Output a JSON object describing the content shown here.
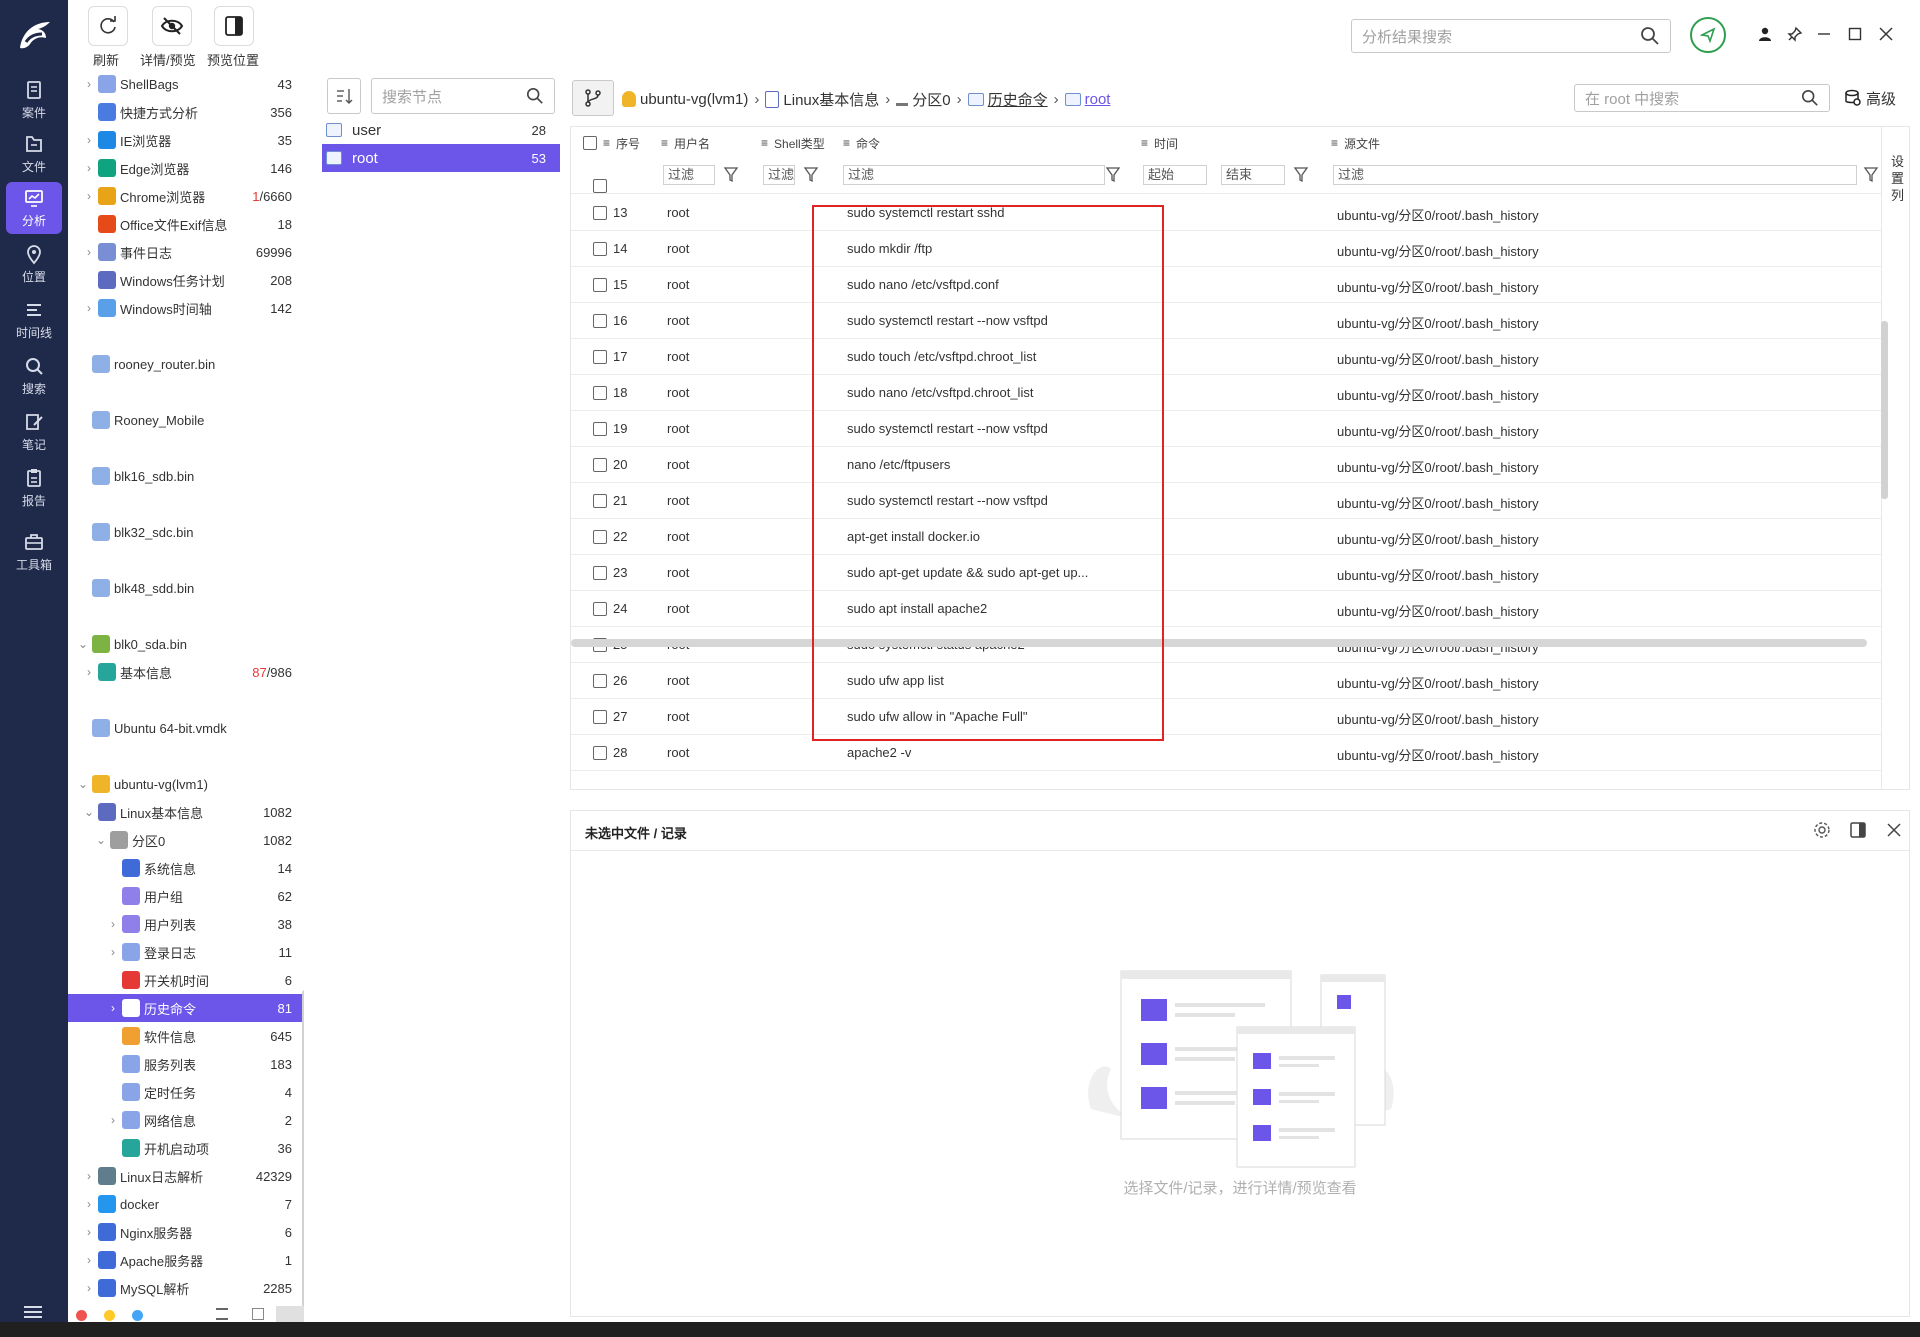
{
  "nav": {
    "items": [
      {
        "id": "case",
        "label": "案件"
      },
      {
        "id": "file",
        "label": "文件"
      },
      {
        "id": "analysis",
        "label": "分析",
        "active": true
      },
      {
        "id": "location",
        "label": "位置"
      },
      {
        "id": "timeline",
        "label": "时间线"
      },
      {
        "id": "search",
        "label": "搜索"
      },
      {
        "id": "notes",
        "label": "笔记"
      },
      {
        "id": "report",
        "label": "报告"
      },
      {
        "id": "toolbox",
        "label": "工具箱"
      }
    ]
  },
  "toolbar": {
    "refresh_label": "刷新",
    "detail_label": "详情/预览",
    "preview_pos_label": "预览位置"
  },
  "global_search": {
    "placeholder": "分析结果搜索"
  },
  "tree": {
    "items": [
      {
        "label": "ShellBags",
        "count": "43",
        "icon": "folder-icon",
        "color": "#8aa4e8",
        "indent": 1,
        "chev": true
      },
      {
        "label": "快捷方式分析",
        "count": "356",
        "icon": "shortcut-icon",
        "color": "#4a7be0",
        "indent": 1,
        "chev": false
      },
      {
        "label": "IE浏览器",
        "count": "35",
        "icon": "ie-icon",
        "color": "#1e88e5",
        "indent": 1,
        "chev": true
      },
      {
        "label": "Edge浏览器",
        "count": "146",
        "icon": "edge-icon",
        "color": "#10a37f",
        "indent": 1,
        "chev": true
      },
      {
        "label": "Chrome浏览器",
        "count_red": "1",
        "count": "/6660",
        "icon": "chrome-icon",
        "color": "#e8a317",
        "indent": 1,
        "chev": true
      },
      {
        "label": "Office文件Exif信息",
        "count": "18",
        "icon": "office-icon",
        "color": "#e64a19",
        "indent": 1,
        "chev": false
      },
      {
        "label": "事件日志",
        "count": "69996",
        "icon": "event-log-icon",
        "color": "#7a8ed6",
        "indent": 1,
        "chev": true
      },
      {
        "label": "Windows任务计划",
        "count": "208",
        "icon": "task-scheduler-icon",
        "color": "#5c6bc0",
        "indent": 1,
        "chev": false
      },
      {
        "label": "Windows时间轴",
        "count": "142",
        "icon": "timeline-icon",
        "color": "#5aa0e8",
        "indent": 1,
        "chev": true
      },
      {
        "label": "rooney_router.bin",
        "count": "",
        "icon": "disk-file-icon",
        "color": "#8fb0e6",
        "indent": 0,
        "chev": false,
        "gap": true
      },
      {
        "label": "Rooney_Mobile",
        "count": "",
        "icon": "disk-file-icon",
        "color": "#8fb0e6",
        "indent": 0,
        "chev": false,
        "gap": true
      },
      {
        "label": "blk16_sdb.bin",
        "count": "",
        "icon": "disk-file-icon",
        "color": "#8fb0e6",
        "indent": 0,
        "chev": false,
        "gap": true
      },
      {
        "label": "blk32_sdc.bin",
        "count": "",
        "icon": "disk-file-icon",
        "color": "#8fb0e6",
        "indent": 0,
        "chev": false,
        "gap": true
      },
      {
        "label": "blk48_sdd.bin",
        "count": "",
        "icon": "disk-file-icon",
        "color": "#8fb0e6",
        "indent": 0,
        "chev": false,
        "gap": true
      },
      {
        "label": "blk0_sda.bin",
        "count": "",
        "icon": "android-icon",
        "color": "#7cb342",
        "indent": 0,
        "chev": true,
        "gap": true
      },
      {
        "label": "基本信息",
        "count_red": "87",
        "count": "/986",
        "icon": "info-icon",
        "color": "#26a69a",
        "indent": 1,
        "chev": true
      },
      {
        "label": "Ubuntu 64-bit.vmdk",
        "count": "",
        "icon": "disk-file-icon",
        "color": "#8fb0e6",
        "indent": 0,
        "chev": false,
        "gap": true
      },
      {
        "label": "ubuntu-vg(lvm1)",
        "count": "",
        "icon": "linux-icon",
        "color": "#f0b429",
        "indent": 0,
        "chev": true,
        "gap": true
      },
      {
        "label": "Linux基本信息",
        "count": "1082",
        "icon": "linux-info-icon",
        "color": "#5c6bc0",
        "indent": 1,
        "chev": true
      },
      {
        "label": "分区0",
        "count": "1082",
        "icon": "partition-icon",
        "color": "#9e9e9e",
        "indent": 2,
        "chev": true
      },
      {
        "label": "系统信息",
        "count": "14",
        "icon": "system-info-icon",
        "color": "#3f6bd8",
        "indent": 3,
        "chev": false
      },
      {
        "label": "用户组",
        "count": "62",
        "icon": "user-group-icon",
        "color": "#8f7fe8",
        "indent": 3,
        "chev": false
      },
      {
        "label": "用户列表",
        "count": "38",
        "icon": "user-list-icon",
        "color": "#8f7fe8",
        "indent": 3,
        "chev": true
      },
      {
        "label": "登录日志",
        "count": "11",
        "icon": "login-log-icon",
        "color": "#8aa4e8",
        "indent": 3,
        "chev": true
      },
      {
        "label": "开关机时间",
        "count": "6",
        "icon": "power-icon",
        "color": "#e53935",
        "indent": 3,
        "chev": false
      },
      {
        "label": "历史命令",
        "count": "81",
        "icon": "history-icon",
        "color": "#ffffff",
        "indent": 3,
        "chev": true,
        "selected": true
      },
      {
        "label": "软件信息",
        "count": "645",
        "icon": "software-icon",
        "color": "#f0a030",
        "indent": 3,
        "chev": false
      },
      {
        "label": "服务列表",
        "count": "183",
        "icon": "service-icon",
        "color": "#8aa4e8",
        "indent": 3,
        "chev": false
      },
      {
        "label": "定时任务",
        "count": "4",
        "icon": "cron-icon",
        "color": "#8aa4e8",
        "indent": 3,
        "chev": false
      },
      {
        "label": "网络信息",
        "count": "2",
        "icon": "network-icon",
        "color": "#8aa4e8",
        "indent": 3,
        "chev": true
      },
      {
        "label": "开机启动项",
        "count": "36",
        "icon": "startup-icon",
        "color": "#26a69a",
        "indent": 3,
        "chev": false
      },
      {
        "label": "Linux日志解析",
        "count": "42329",
        "icon": "linux-log-icon",
        "color": "#607d8b",
        "indent": 1,
        "chev": true
      },
      {
        "label": "docker",
        "count": "7",
        "icon": "docker-icon",
        "color": "#2496ed",
        "indent": 1,
        "chev": true
      },
      {
        "label": "Nginx服务器",
        "count": "6",
        "icon": "nginx-icon",
        "color": "#3f6bd8",
        "indent": 1,
        "chev": true
      },
      {
        "label": "Apache服务器",
        "count": "1",
        "icon": "apache-icon",
        "color": "#3f6bd8",
        "indent": 1,
        "chev": true
      },
      {
        "label": "MySQL解析",
        "count": "2285",
        "icon": "mysql-icon",
        "color": "#3f6bd8",
        "indent": 1,
        "chev": true
      }
    ]
  },
  "nodes": {
    "search_placeholder": "搜索节点",
    "items": [
      {
        "name": "user",
        "count": "28"
      },
      {
        "name": "root",
        "count": "53",
        "selected": true
      }
    ]
  },
  "breadcrumb": {
    "items": [
      "ubuntu-vg(lvm1)",
      "Linux基本信息",
      "分区0",
      "历史命令",
      "root"
    ]
  },
  "table_search": {
    "placeholder": "在 root 中搜索",
    "advanced_label": "高级"
  },
  "table": {
    "headers": [
      "序号",
      "用户名",
      "Shell类型",
      "命令",
      "时间",
      "源文件"
    ],
    "filter_label": "过滤",
    "start_label": "起始",
    "end_label": "结束",
    "settings_label": "设置列",
    "rows": [
      {
        "n": "13",
        "user": "root",
        "cmd": "sudo systemctl restart sshd",
        "src": "ubuntu-vg/分区0/root/.bash_history"
      },
      {
        "n": "14",
        "user": "root",
        "cmd": "sudo mkdir /ftp",
        "src": "ubuntu-vg/分区0/root/.bash_history"
      },
      {
        "n": "15",
        "user": "root",
        "cmd": "sudo nano /etc/vsftpd.conf",
        "src": "ubuntu-vg/分区0/root/.bash_history"
      },
      {
        "n": "16",
        "user": "root",
        "cmd": "sudo systemctl restart --now vsftpd",
        "src": "ubuntu-vg/分区0/root/.bash_history"
      },
      {
        "n": "17",
        "user": "root",
        "cmd": "sudo touch /etc/vsftpd.chroot_list",
        "src": "ubuntu-vg/分区0/root/.bash_history"
      },
      {
        "n": "18",
        "user": "root",
        "cmd": "sudo nano /etc/vsftpd.chroot_list",
        "src": "ubuntu-vg/分区0/root/.bash_history"
      },
      {
        "n": "19",
        "user": "root",
        "cmd": "sudo systemctl restart --now vsftpd",
        "src": "ubuntu-vg/分区0/root/.bash_history"
      },
      {
        "n": "20",
        "user": "root",
        "cmd": "nano /etc/ftpusers",
        "src": "ubuntu-vg/分区0/root/.bash_history"
      },
      {
        "n": "21",
        "user": "root",
        "cmd": "sudo systemctl restart --now vsftpd",
        "src": "ubuntu-vg/分区0/root/.bash_history"
      },
      {
        "n": "22",
        "user": "root",
        "cmd": "apt-get install docker.io",
        "src": "ubuntu-vg/分区0/root/.bash_history"
      },
      {
        "n": "23",
        "user": "root",
        "cmd": "sudo apt-get update && sudo apt-get up...",
        "src": "ubuntu-vg/分区0/root/.bash_history"
      },
      {
        "n": "24",
        "user": "root",
        "cmd": "sudo apt install apache2",
        "src": "ubuntu-vg/分区0/root/.bash_history"
      },
      {
        "n": "25",
        "user": "root",
        "cmd": "sudo systemctl status apache2",
        "src": "ubuntu-vg/分区0/root/.bash_history"
      },
      {
        "n": "26",
        "user": "root",
        "cmd": "sudo ufw app list",
        "src": "ubuntu-vg/分区0/root/.bash_history"
      },
      {
        "n": "27",
        "user": "root",
        "cmd": "sudo ufw allow in \"Apache Full\"",
        "src": "ubuntu-vg/分区0/root/.bash_history"
      },
      {
        "n": "28",
        "user": "root",
        "cmd": "apache2 -v",
        "src": "ubuntu-vg/分区0/root/.bash_history"
      }
    ]
  },
  "preview": {
    "title": "未选中文件 / 记录",
    "hint": "选择文件/记录，进行详情/预览查看"
  },
  "colors": {
    "accent": "#6c55e9",
    "rail_bg": "#1f2a4a",
    "highlight_box": "#e02424",
    "green_status": "#2e9e4f"
  }
}
